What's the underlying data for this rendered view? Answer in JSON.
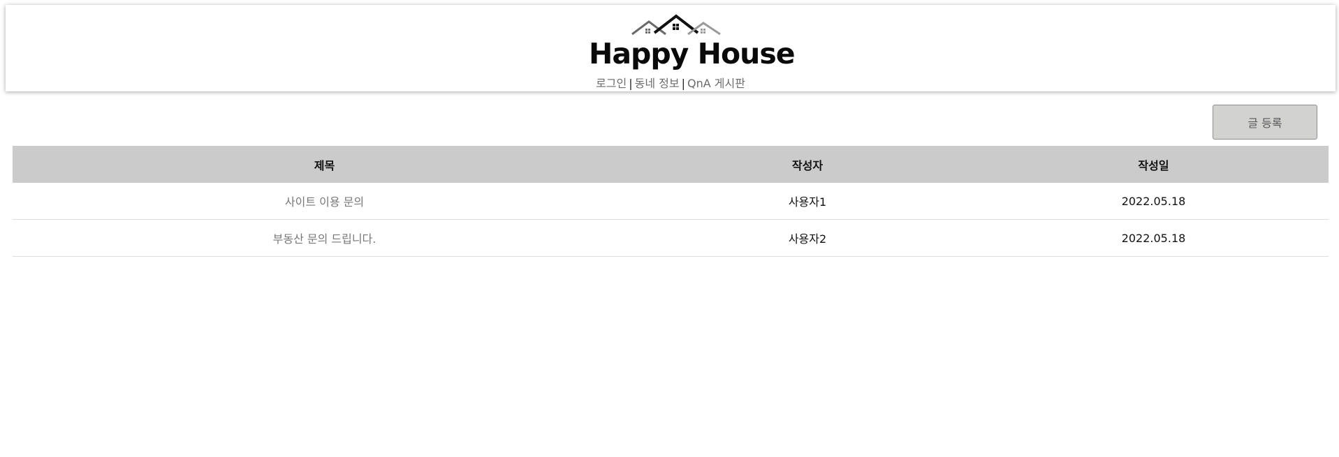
{
  "header": {
    "logo_text": "Happy House",
    "nav": [
      {
        "label": "로그인"
      },
      {
        "label": "동네 정보"
      },
      {
        "label": "QnA 게시판"
      }
    ],
    "separator": "|"
  },
  "actions": {
    "write_label": "글 등록"
  },
  "table": {
    "columns": [
      "제목",
      "작성자",
      "작성일"
    ],
    "rows": [
      {
        "title": "사이트 이용 문의",
        "writer": "사용자1",
        "date": "2022.05.18"
      },
      {
        "title": "부동산 문의 드립니다.",
        "writer": "사용자2",
        "date": "2022.05.18"
      }
    ]
  },
  "colors": {
    "header_row_bg": "#cbcbcb",
    "button_bg": "#d2d3d1",
    "link_gray": "#777777"
  }
}
